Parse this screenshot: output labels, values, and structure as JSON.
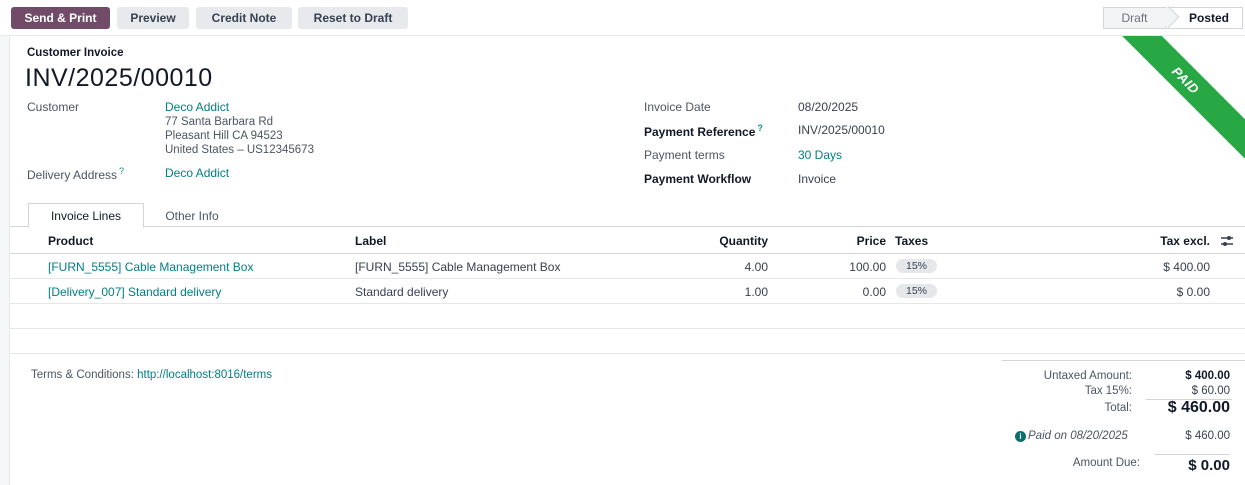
{
  "toolbar": {
    "send_print": "Send & Print",
    "preview": "Preview",
    "credit_note": "Credit Note",
    "reset_to_draft": "Reset to Draft"
  },
  "status": {
    "steps": [
      "Draft",
      "Posted"
    ],
    "current": "Posted"
  },
  "ribbon": "PAID",
  "invoice": {
    "type_label": "Customer Invoice",
    "name": "INV/2025/00010",
    "customer_label": "Customer",
    "customer_name": "Deco Addict",
    "address": [
      "77 Santa Barbara Rd",
      "Pleasant Hill CA 94523",
      "United States – US12345673"
    ],
    "delivery_label": "Delivery Address",
    "delivery_value": "Deco Addict",
    "help_mark": "?",
    "invoice_date_label": "Invoice Date",
    "invoice_date": "08/20/2025",
    "payment_reference_label": "Payment Reference",
    "payment_reference": "INV/2025/00010",
    "payment_terms_label": "Payment terms",
    "payment_terms": "30 Days",
    "payment_workflow_label": "Payment Workflow",
    "payment_workflow": "Invoice"
  },
  "tabs": [
    {
      "label": "Invoice Lines",
      "active": true
    },
    {
      "label": "Other Info",
      "active": false
    }
  ],
  "lines": {
    "headers": {
      "product": "Product",
      "label": "Label",
      "quantity": "Quantity",
      "price": "Price",
      "taxes": "Taxes",
      "tax_excl": "Tax excl."
    },
    "rows": [
      {
        "product": "[FURN_5555] Cable Management Box",
        "label": "[FURN_5555] Cable Management Box",
        "quantity": "4.00",
        "price": "100.00",
        "taxes": "15%",
        "subtotal": "$ 400.00"
      },
      {
        "product": "[Delivery_007] Standard delivery",
        "label": "Standard delivery",
        "quantity": "1.00",
        "price": "0.00",
        "taxes": "15%",
        "subtotal": "$ 0.00"
      }
    ]
  },
  "terms": {
    "label": "Terms & Conditions:",
    "link": "http://localhost:8016/terms"
  },
  "totals": {
    "untaxed_label": "Untaxed Amount:",
    "untaxed": "$ 400.00",
    "tax_label": "Tax 15%:",
    "tax": "$ 60.00",
    "total_label": "Total:",
    "total": "$ 460.00",
    "paid_label": "Paid on 08/20/2025",
    "paid": "$ 460.00",
    "due_label": "Amount Due:",
    "due": "$ 0.00"
  },
  "colors": {
    "primary": "#714b67",
    "link": "#017e84",
    "ribbon": "#28a745"
  },
  "icons": [
    "settings-sliders-icon",
    "info-circle-icon"
  ]
}
